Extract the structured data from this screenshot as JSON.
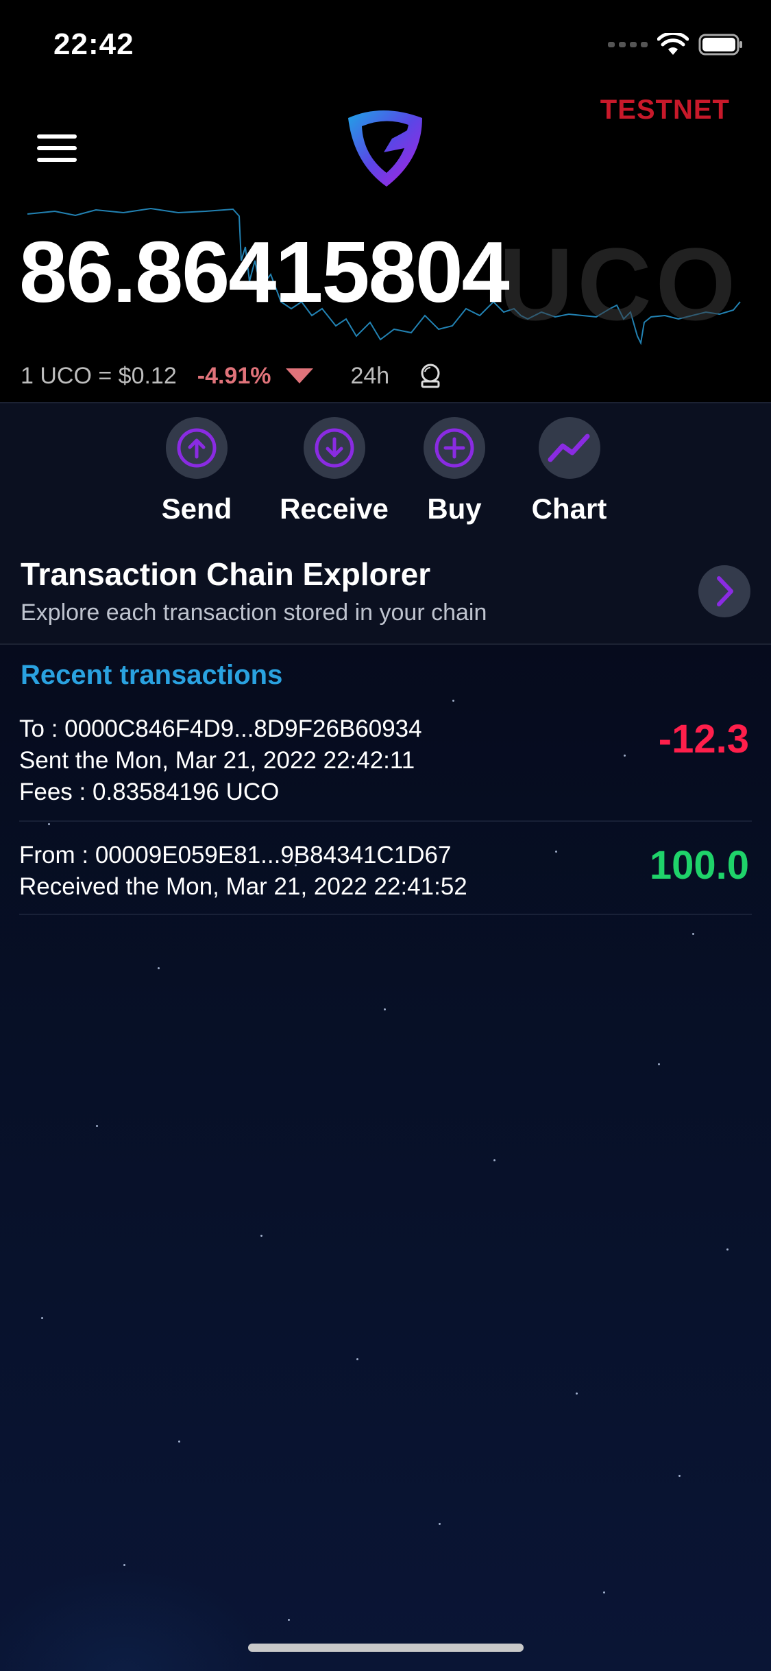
{
  "status_bar": {
    "time": "22:42"
  },
  "header": {
    "network_label": "TESTNET"
  },
  "balance": {
    "amount": "86.86415804",
    "unit": "UCO"
  },
  "price_info": {
    "price": "1 UCO = $0.12",
    "change": "-4.91%",
    "period": "24h"
  },
  "actions": [
    {
      "label": "Send",
      "icon": "arrow-up-circle-icon"
    },
    {
      "label": "Receive",
      "icon": "arrow-down-circle-icon"
    },
    {
      "label": "Buy",
      "icon": "plus-circle-icon"
    },
    {
      "label": "Chart",
      "icon": "trend-chart-icon"
    }
  ],
  "explorer": {
    "title": "Transaction Chain Explorer",
    "subtitle": "Explore each transaction stored in your chain"
  },
  "recent": {
    "title": "Recent transactions",
    "items": [
      {
        "line1": "To : 0000C846F4D9...8D9F26B60934",
        "line2": "Sent the Mon, Mar 21, 2022 22:42:11",
        "line3": "Fees : 0.83584196 UCO",
        "amount": "-12.3"
      },
      {
        "line1": "From : 00009E059E81...9B84341C1D67",
        "line2": "Received the Mon, Mar 21, 2022 22:41:52",
        "amount": "100.0"
      }
    ]
  },
  "colors": {
    "accent_purple": "#8a2be2",
    "accent_blue": "#2aa2e0",
    "negative": "#ff1f4b",
    "positive": "#1fd36a",
    "testnet": "#c8192a"
  }
}
